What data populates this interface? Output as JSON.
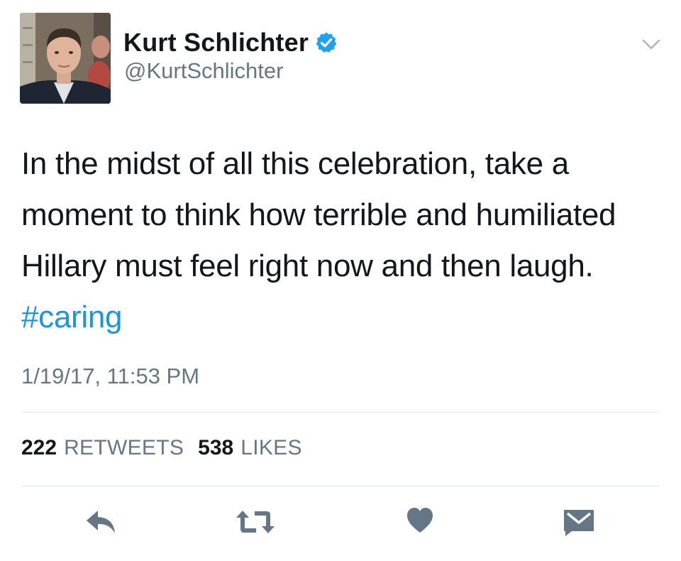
{
  "colors": {
    "text": "#14171a",
    "secondary": "#657786",
    "link": "#1b95e0",
    "verified": "#1da1f2",
    "divider": "#e1e8ed",
    "action_icon": "#657786"
  },
  "header": {
    "display_name": "Kurt Schlichter",
    "handle": "@KurtSchlichter",
    "verified_icon": "verified-badge-icon",
    "menu_icon": "chevron-down-icon"
  },
  "tweet": {
    "text": "In the midst of all this celebration, take a moment to think how terrible and humiliated Hillary must feel right now and then laugh. ",
    "hashtag": "#caring",
    "timestamp": "1/19/17, 11:53 PM"
  },
  "stats": {
    "retweets_count": "222",
    "retweets_label": "RETWEETS",
    "likes_count": "538",
    "likes_label": "LIKES"
  },
  "actions": [
    {
      "name": "reply",
      "icon": "reply-icon"
    },
    {
      "name": "retweet",
      "icon": "retweet-icon"
    },
    {
      "name": "like",
      "icon": "heart-icon"
    },
    {
      "name": "direct-message",
      "icon": "envelope-icon"
    }
  ]
}
